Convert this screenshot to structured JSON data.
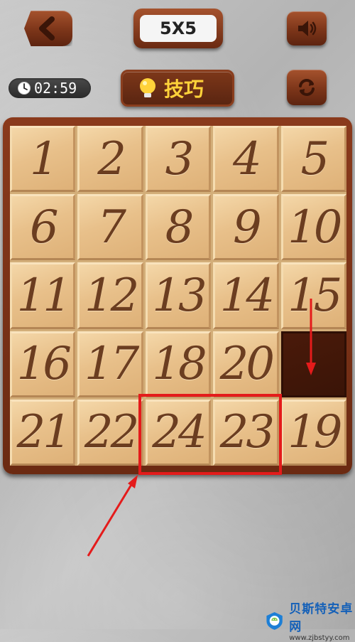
{
  "header": {
    "level_label": "5X5",
    "timer_value": "02:59",
    "tips_label": "技巧"
  },
  "board": {
    "tiles": [
      "1",
      "2",
      "3",
      "4",
      "5",
      "6",
      "7",
      "8",
      "9",
      "10",
      "11",
      "12",
      "13",
      "14",
      "15",
      "16",
      "17",
      "18",
      "20",
      "",
      "21",
      "22",
      "24",
      "23",
      "19"
    ]
  },
  "watermark": {
    "title": "贝斯特安卓网",
    "url": "www.zjbstyy.com"
  },
  "colors": {
    "wood_dark": "#6b2a12",
    "tile": "#e8c08a",
    "number": "#6b3d20",
    "annotation": "#e41b1b",
    "tips_text": "#ffd23a"
  },
  "icons": [
    "back-arrow-icon",
    "speaker-icon",
    "clock-icon",
    "lightbulb-icon",
    "refresh-icon"
  ]
}
